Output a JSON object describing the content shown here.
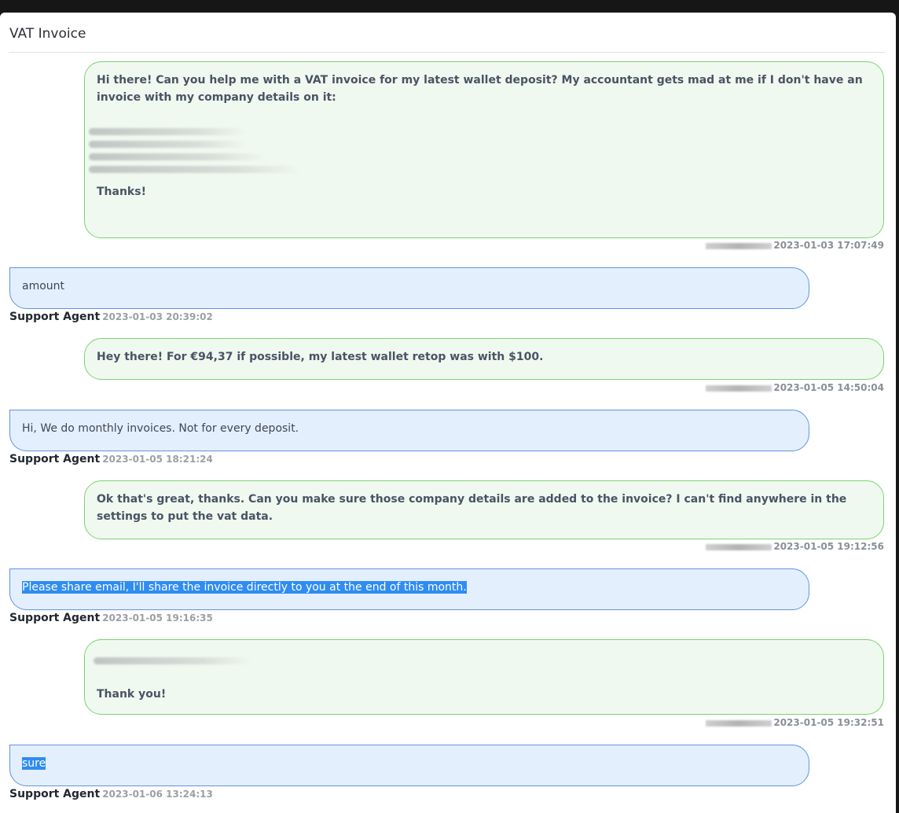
{
  "title": "VAT Invoice",
  "messages": [
    {
      "side": "user",
      "paragraph1": "Hi there! Can you help me with a VAT invoice for my latest wallet deposit? My accountant gets mad at me if I don't have an invoice with my company details on it:",
      "closing": "Thanks!",
      "timestamp": "2023-01-03 17:07:49"
    },
    {
      "side": "agent",
      "text": "amount",
      "sender": "Support Agent",
      "timestamp": "2023-01-03 20:39:02"
    },
    {
      "side": "user",
      "text": "Hey there! For €94,37 if possible, my latest wallet retop was with $100.",
      "timestamp": "2023-01-05 14:50:04"
    },
    {
      "side": "agent",
      "text": "Hi, We do monthly invoices. Not for every deposit.",
      "sender": "Support Agent",
      "timestamp": "2023-01-05 18:21:24"
    },
    {
      "side": "user",
      "text": "Ok that's great, thanks. Can you make sure those company details are added to the invoice? I can't find anywhere in the settings to put the vat data.",
      "timestamp": "2023-01-05 19:12:56"
    },
    {
      "side": "agent",
      "text": "Please share email, I'll share the invoice directly to you at the end of this month.",
      "sender": "Support Agent",
      "timestamp": "2023-01-05 19:16:35"
    },
    {
      "side": "user",
      "text": "Thank you!",
      "timestamp": "2023-01-05 19:32:51"
    },
    {
      "side": "agent",
      "text": "sure",
      "sender": "Support Agent",
      "timestamp": "2023-01-06 13:24:13"
    }
  ]
}
